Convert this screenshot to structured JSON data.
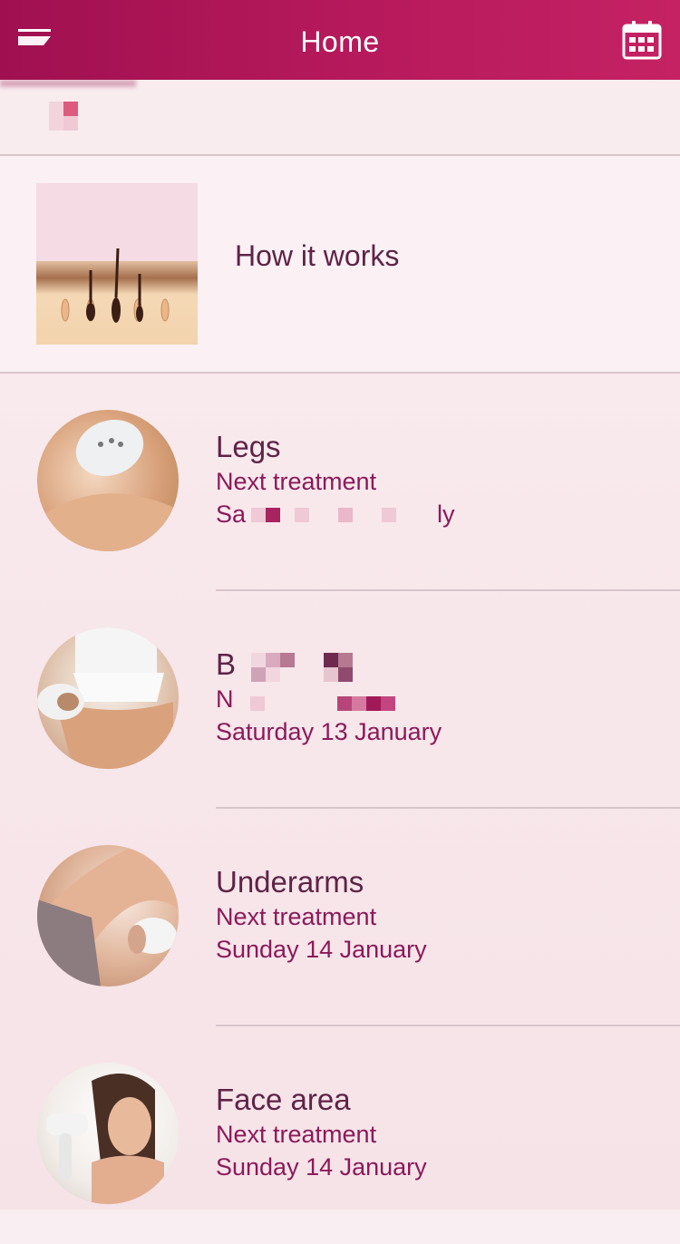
{
  "header": {
    "title": "Home",
    "menu_icon": "menu-icon",
    "calendar_icon": "calendar-icon"
  },
  "how_it_works": {
    "label": "How it works"
  },
  "treatments": [
    {
      "area": "Legs",
      "next_label": "Next treatment",
      "date": "Sa",
      "date_suffix": "ly"
    },
    {
      "area": "B",
      "next_label": "N",
      "date": "Saturday 13 January"
    },
    {
      "area": "Underarms",
      "next_label": "Next treatment",
      "date": "Sunday 14 January"
    },
    {
      "area": "Face area",
      "next_label": "Next treatment",
      "date": "Sunday 14 January"
    }
  ],
  "colors": {
    "header_start": "#a01050",
    "header_end": "#c42263",
    "title_text": "#5f2347",
    "accent_text": "#8b1a5a"
  }
}
